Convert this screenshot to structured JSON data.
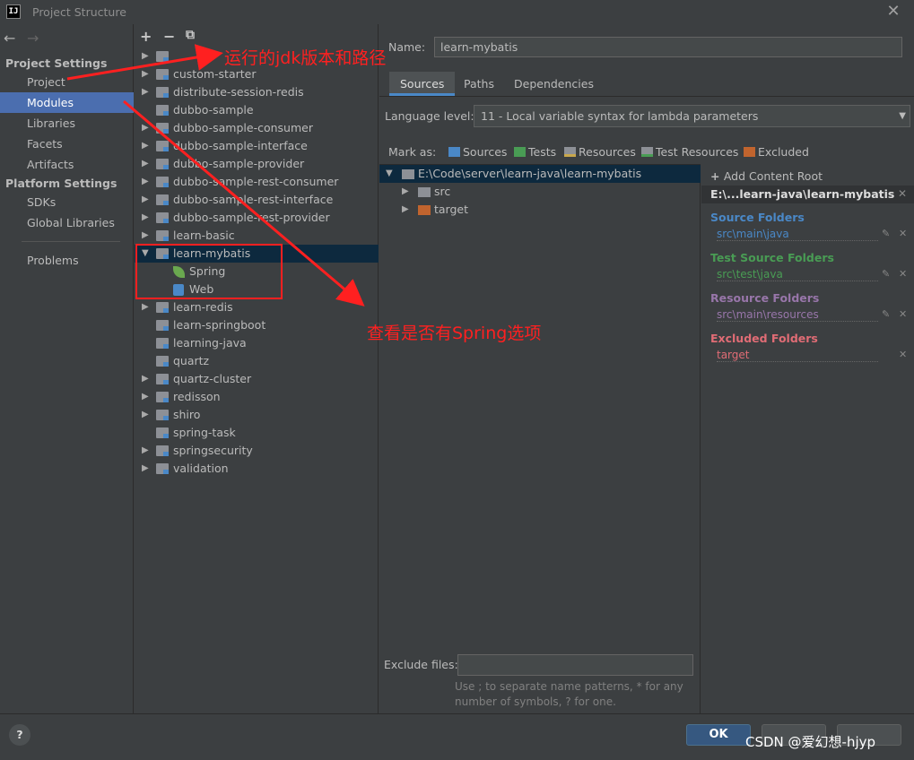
{
  "window": {
    "title": "Project Structure",
    "app_icon": "IJ"
  },
  "nav": {
    "back_icon": "arrow-left-icon",
    "forward_icon": "arrow-right-icon",
    "project_settings_header": "Project Settings",
    "project_items": [
      "Project",
      "Modules",
      "Libraries",
      "Facets",
      "Artifacts"
    ],
    "platform_settings_header": "Platform Settings",
    "platform_items": [
      "SDKs",
      "Global Libraries"
    ],
    "problems": "Problems",
    "selected": "Modules"
  },
  "tree": {
    "toolbar": [
      "+",
      "−",
      "⧉"
    ],
    "modules": [
      {
        "label": "",
        "expandable": true
      },
      {
        "label": "custom-starter",
        "expandable": true
      },
      {
        "label": "distribute-session-redis",
        "expandable": true
      },
      {
        "label": "dubbo-sample",
        "expandable": false
      },
      {
        "label": "dubbo-sample-consumer",
        "expandable": true
      },
      {
        "label": "dubbo-sample-interface",
        "expandable": true
      },
      {
        "label": "dubbo-sample-provider",
        "expandable": true
      },
      {
        "label": "dubbo-sample-rest-consumer",
        "expandable": true
      },
      {
        "label": "dubbo-sample-rest-interface",
        "expandable": true
      },
      {
        "label": "dubbo-sample-rest-provider",
        "expandable": true
      },
      {
        "label": "learn-basic",
        "expandable": true
      },
      {
        "label": "learn-mybatis",
        "expandable": true,
        "expanded": true,
        "selected": true
      },
      {
        "label": "Spring",
        "child": true,
        "icon": "spring-leaf-icon"
      },
      {
        "label": "Web",
        "child": true,
        "icon": "web-facet-icon"
      },
      {
        "label": "learn-redis",
        "expandable": true
      },
      {
        "label": "learn-springboot",
        "expandable": false
      },
      {
        "label": "learning-java",
        "expandable": false
      },
      {
        "label": "quartz",
        "expandable": false
      },
      {
        "label": "quartz-cluster",
        "expandable": true
      },
      {
        "label": "redisson",
        "expandable": true
      },
      {
        "label": "shiro",
        "expandable": true
      },
      {
        "label": "spring-task",
        "expandable": false
      },
      {
        "label": "springsecurity",
        "expandable": true
      },
      {
        "label": "validation",
        "expandable": true
      }
    ]
  },
  "detail": {
    "name_label": "Name:",
    "name_value": "learn-mybatis",
    "tabs": [
      "Sources",
      "Paths",
      "Dependencies"
    ],
    "active_tab": "Sources",
    "language_level_label": "Language level:",
    "language_level_value": "11 - Local variable syntax for lambda parameters",
    "mark_as_label": "Mark as:",
    "mark_as": [
      {
        "label": "Sources",
        "color": "#4a88c7"
      },
      {
        "label": "Tests",
        "color": "#499c54"
      },
      {
        "label": "Resources",
        "color": "#8d9096"
      },
      {
        "label": "Test Resources",
        "color": "#8d9096"
      },
      {
        "label": "Excluded",
        "color": "#c1642e"
      }
    ],
    "content_root": "E:\\Code\\server\\learn-java\\learn-mybatis",
    "content_children": [
      {
        "label": "src",
        "color": "#8d9096"
      },
      {
        "label": "target",
        "color": "#c1642e"
      }
    ],
    "add_content_root": "Add Content Root",
    "root_header": "E:\\...learn-java\\learn-mybatis",
    "folders": [
      {
        "title": "Source Folders",
        "path": "src\\main\\java",
        "color": "#4a88c7"
      },
      {
        "title": "Test Source Folders",
        "path": "src\\test\\java",
        "color": "#499c54"
      },
      {
        "title": "Resource Folders",
        "path": "src\\main\\resources",
        "color": "#9876aa"
      },
      {
        "title": "Excluded Folders",
        "path": "target",
        "color": "#e06c75"
      }
    ],
    "exclude_files_label": "Exclude files:",
    "exclude_files_value": "",
    "exclude_hint": "Use ; to separate name patterns, * for any number of symbols, ? for one."
  },
  "buttons": {
    "help": "?",
    "ok": "OK",
    "cancel": "",
    "apply": ""
  },
  "watermark": "CSDN @爱幻想-hjyp",
  "annotations": {
    "text_jdk": "运行的jdk版本和路径",
    "text_spring": "查看是否有Spring选项",
    "color": "#ff2020"
  }
}
